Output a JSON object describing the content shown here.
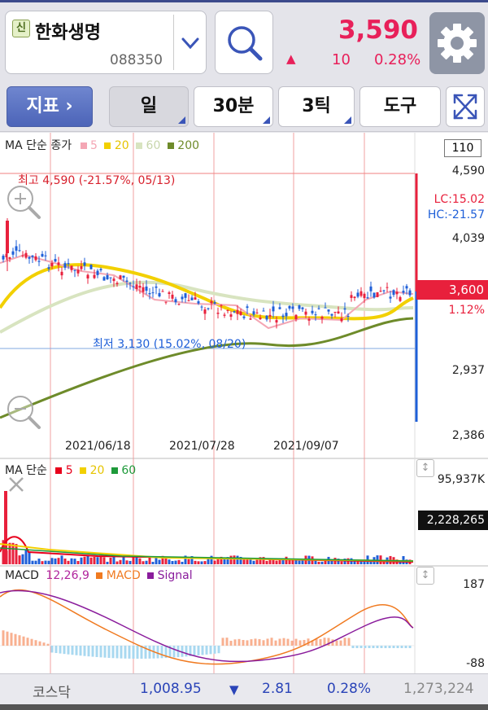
{
  "header": {
    "badge": "신",
    "stock_name": "한화생명",
    "stock_code": "088350",
    "price": "3,590",
    "change_arrow": "▲",
    "change": "10",
    "change_pct": "0.28%"
  },
  "toolbar": {
    "indicator_label": "지표 ›",
    "day_label": "일",
    "min30_label": "30분",
    "tick3_label": "3틱",
    "tools_label": "도구"
  },
  "price_chart": {
    "legend_title": "MA 단순 종가",
    "ma_items": [
      {
        "label": "5",
        "color": "#f4a6b4"
      },
      {
        "label": "20",
        "color": "#f2d000"
      },
      {
        "label": "60",
        "color": "#d8e4c0"
      },
      {
        "label": "200",
        "color": "#6e8b2a"
      }
    ],
    "count_box": "110",
    "axis_ticks": [
      "4,590",
      "4,039",
      "3,600",
      "2,937",
      "2,386"
    ],
    "current_price_tag": "3,600",
    "current_pct": "1.12%",
    "lc_label": "LC:15.02",
    "hc_label": "HC:-21.57",
    "high_note": "최고 4,590 (-21.57%, 05/13)",
    "low_note": "최저 3,130 (15.02%, 08/20)",
    "dates": [
      "2021/06/18",
      "2021/07/28",
      "2021/09/07"
    ]
  },
  "volume_chart": {
    "legend_title": "MA 단순",
    "ma_items": [
      {
        "label": "5",
        "color": "#e8001c"
      },
      {
        "label": "20",
        "color": "#f2d000"
      },
      {
        "label": "60",
        "color": "#1e9a3a"
      }
    ],
    "axis_max": "95,937K",
    "current_tag": "2,228,265"
  },
  "macd_chart": {
    "title": "MACD",
    "params": "12,26,9",
    "macd_label": "MACD",
    "signal_label": "Signal",
    "macd_color": "#f07a20",
    "signal_color": "#8a1c9c",
    "axis_top": "187",
    "axis_bottom": "-88"
  },
  "market_bar": {
    "name": "코스닥",
    "value": "1,008.95",
    "arrow": "▼",
    "change": "2.81",
    "pct": "0.28%",
    "volume": "1,273,224"
  }
}
